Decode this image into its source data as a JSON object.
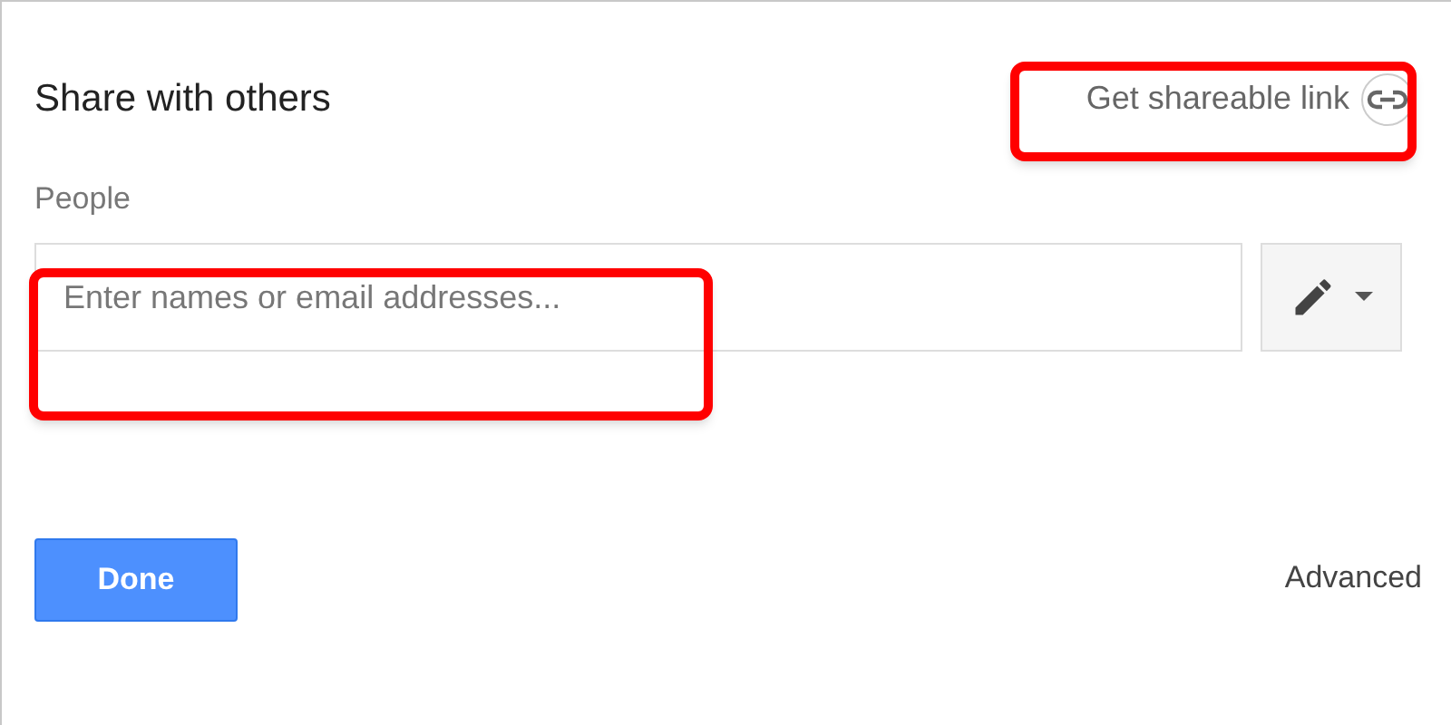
{
  "dialog": {
    "title": "Share with others",
    "shareable_link": {
      "label": "Get shareable link"
    },
    "people": {
      "label": "People",
      "placeholder": "Enter names or email addresses..."
    },
    "done_button": "Done",
    "advanced_link": "Advanced"
  }
}
